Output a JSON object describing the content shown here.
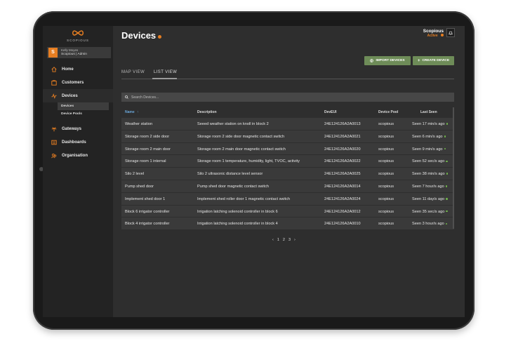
{
  "brand": {
    "logo_text": "SCOPIOUS"
  },
  "user": {
    "initial": "S",
    "name": "Kelly Moyes",
    "role": "Scopious | Admin"
  },
  "nav": {
    "items": [
      {
        "label": "Home",
        "icon": "home-icon"
      },
      {
        "label": "Customers",
        "icon": "customers-icon"
      },
      {
        "label": "Devices",
        "icon": "devices-icon"
      },
      {
        "label": "Gateways",
        "icon": "gateways-icon"
      },
      {
        "label": "Dashboards",
        "icon": "dashboards-icon"
      },
      {
        "label": "Organisation",
        "icon": "organisation-icon"
      }
    ],
    "sub_items": [
      {
        "label": "Devices"
      },
      {
        "label": "Device Pools"
      }
    ]
  },
  "header": {
    "title": "Devices",
    "account_name": "Scopious",
    "account_status": "Active"
  },
  "actions": {
    "import_label": "IMPORT DEVICES",
    "create_label": "CREATE DEVICE"
  },
  "tabs": [
    {
      "label": "MAP VIEW"
    },
    {
      "label": "LIST VIEW"
    }
  ],
  "search": {
    "placeholder": "Search Devices..."
  },
  "table": {
    "columns": [
      "Name",
      "Description",
      "DevEUI",
      "Device Pool",
      "Last Seen"
    ],
    "rows": [
      {
        "name": "Weather station",
        "description": "Seeed weather station on knoll in block 2",
        "deveui": "24E124126A2A0013",
        "pool": "scopious",
        "seen": "Seen 17 min/s ago"
      },
      {
        "name": "Storage room 2 side door",
        "description": "Storage room 2 side door magnetic contact switch",
        "deveui": "24E124126A2A0021",
        "pool": "scopious",
        "seen": "Seen 6 min/s ago"
      },
      {
        "name": "Storage room 2 main door",
        "description": "Storage room 2 main door magnetic contact switch",
        "deveui": "24E124126A2A0020",
        "pool": "scopious",
        "seen": "Seen 9 min/s ago"
      },
      {
        "name": "Storage room 1 internal",
        "description": "Storage room 1 temperature, humidity, light, TVOC, activity",
        "deveui": "24E124126A2A0022",
        "pool": "scopious",
        "seen": "Seen 52 sec/s ago"
      },
      {
        "name": "Silo 2 level",
        "description": "Silo 2 ultrasonic distance level sensor",
        "deveui": "24E124126A2A0025",
        "pool": "scopious",
        "seen": "Seen 38 min/s ago"
      },
      {
        "name": "Pump shed door",
        "description": "Pump shed door magnetic contact switch",
        "deveui": "24E124126A2A0014",
        "pool": "scopious",
        "seen": "Seen 7 hour/s ago"
      },
      {
        "name": "Implement shed door 1",
        "description": "Implement shed roller door 1 magnetic contact switch",
        "deveui": "24E124126A2A0024",
        "pool": "scopious",
        "seen": "Seen 11 day/s ago"
      },
      {
        "name": "Block 6 irrigator controller",
        "description": "Irrigation latching solenoid controller in block 6",
        "deveui": "24E124126A2A0012",
        "pool": "scopious",
        "seen": "Seen 35 sec/s ago"
      },
      {
        "name": "Block 4 irrigator controller",
        "description": "Irrigation latching solenoid controller in block 4",
        "deveui": "24E124126A2A0010",
        "pool": "scopious",
        "seen": "Seen 3 hour/s ago"
      }
    ]
  },
  "pagination": {
    "prev": "‹",
    "pages": [
      "1",
      "2",
      "3"
    ],
    "next": "›"
  },
  "colors": {
    "accent": "#e67e22",
    "button": "#6e8c58",
    "online": "#6fb34a",
    "link": "#6aa6d8"
  }
}
